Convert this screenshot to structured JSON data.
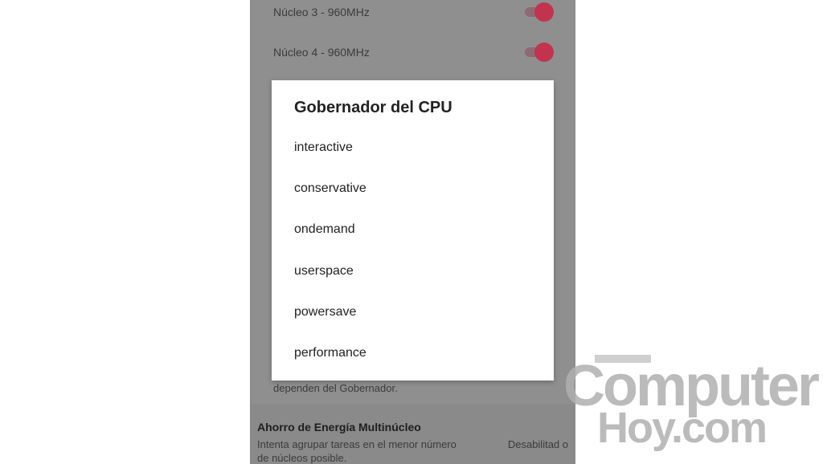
{
  "background_rows": [
    {
      "label": "Núcleo 3 - 960MHz"
    },
    {
      "label": "Núcleo 4 - 960MHz"
    }
  ],
  "background_under_text": "dependen del Gobernador.",
  "section": {
    "title": "Ahorro de Energía Multinúcleo",
    "description": "Intenta agrupar tareas en el menor número de núcleos posible.",
    "right_value": "Desabilitad o"
  },
  "dialog": {
    "title": "Gobernador del CPU",
    "options": [
      "interactive",
      "conservative",
      "ondemand",
      "userspace",
      "powersave",
      "performance"
    ]
  },
  "watermark": {
    "line1": "Computer",
    "line2": "Hoy.com"
  },
  "colors": {
    "toggle_accent": "#c2334f",
    "scrim": "#8a8a8a"
  }
}
